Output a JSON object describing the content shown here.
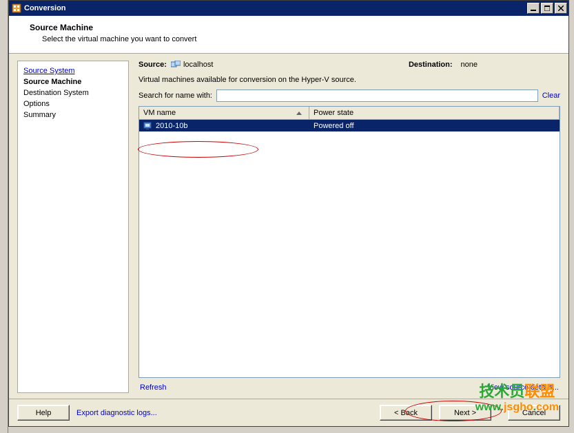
{
  "window": {
    "title": "Conversion"
  },
  "banner": {
    "heading": "Source Machine",
    "subtext": "Select the virtual machine you want to convert"
  },
  "sidebar": {
    "items": [
      {
        "label": "Source System",
        "style": "link"
      },
      {
        "label": "Source Machine",
        "style": "bold"
      },
      {
        "label": "Destination System",
        "style": "plain"
      },
      {
        "label": "Options",
        "style": "plain"
      },
      {
        "label": "Summary",
        "style": "plain"
      }
    ]
  },
  "main": {
    "source_label": "Source:",
    "source_value": "localhost",
    "dest_label": "Destination:",
    "dest_value": "none",
    "available_text": "Virtual machines available for conversion on the Hyper-V source.",
    "search_label": "Search for name with:",
    "search_value": "",
    "clear_label": "Clear",
    "columns": {
      "name": "VM name",
      "power": "Power state"
    },
    "rows": [
      {
        "name": "2010-10b",
        "power": "Powered off",
        "selected": true
      }
    ],
    "refresh_label": "Refresh",
    "view_details_label": "View source details..."
  },
  "footer": {
    "help": "Help",
    "export": "Export diagnostic logs...",
    "back": "< Back",
    "next": "Next >",
    "cancel": "Cancel"
  },
  "watermark": {
    "line1a": "技术员",
    "line1b": "联盟",
    "url_w": "www.",
    "url_mid": "jsgho",
    "url_dot": ".",
    "url_end": "com"
  }
}
